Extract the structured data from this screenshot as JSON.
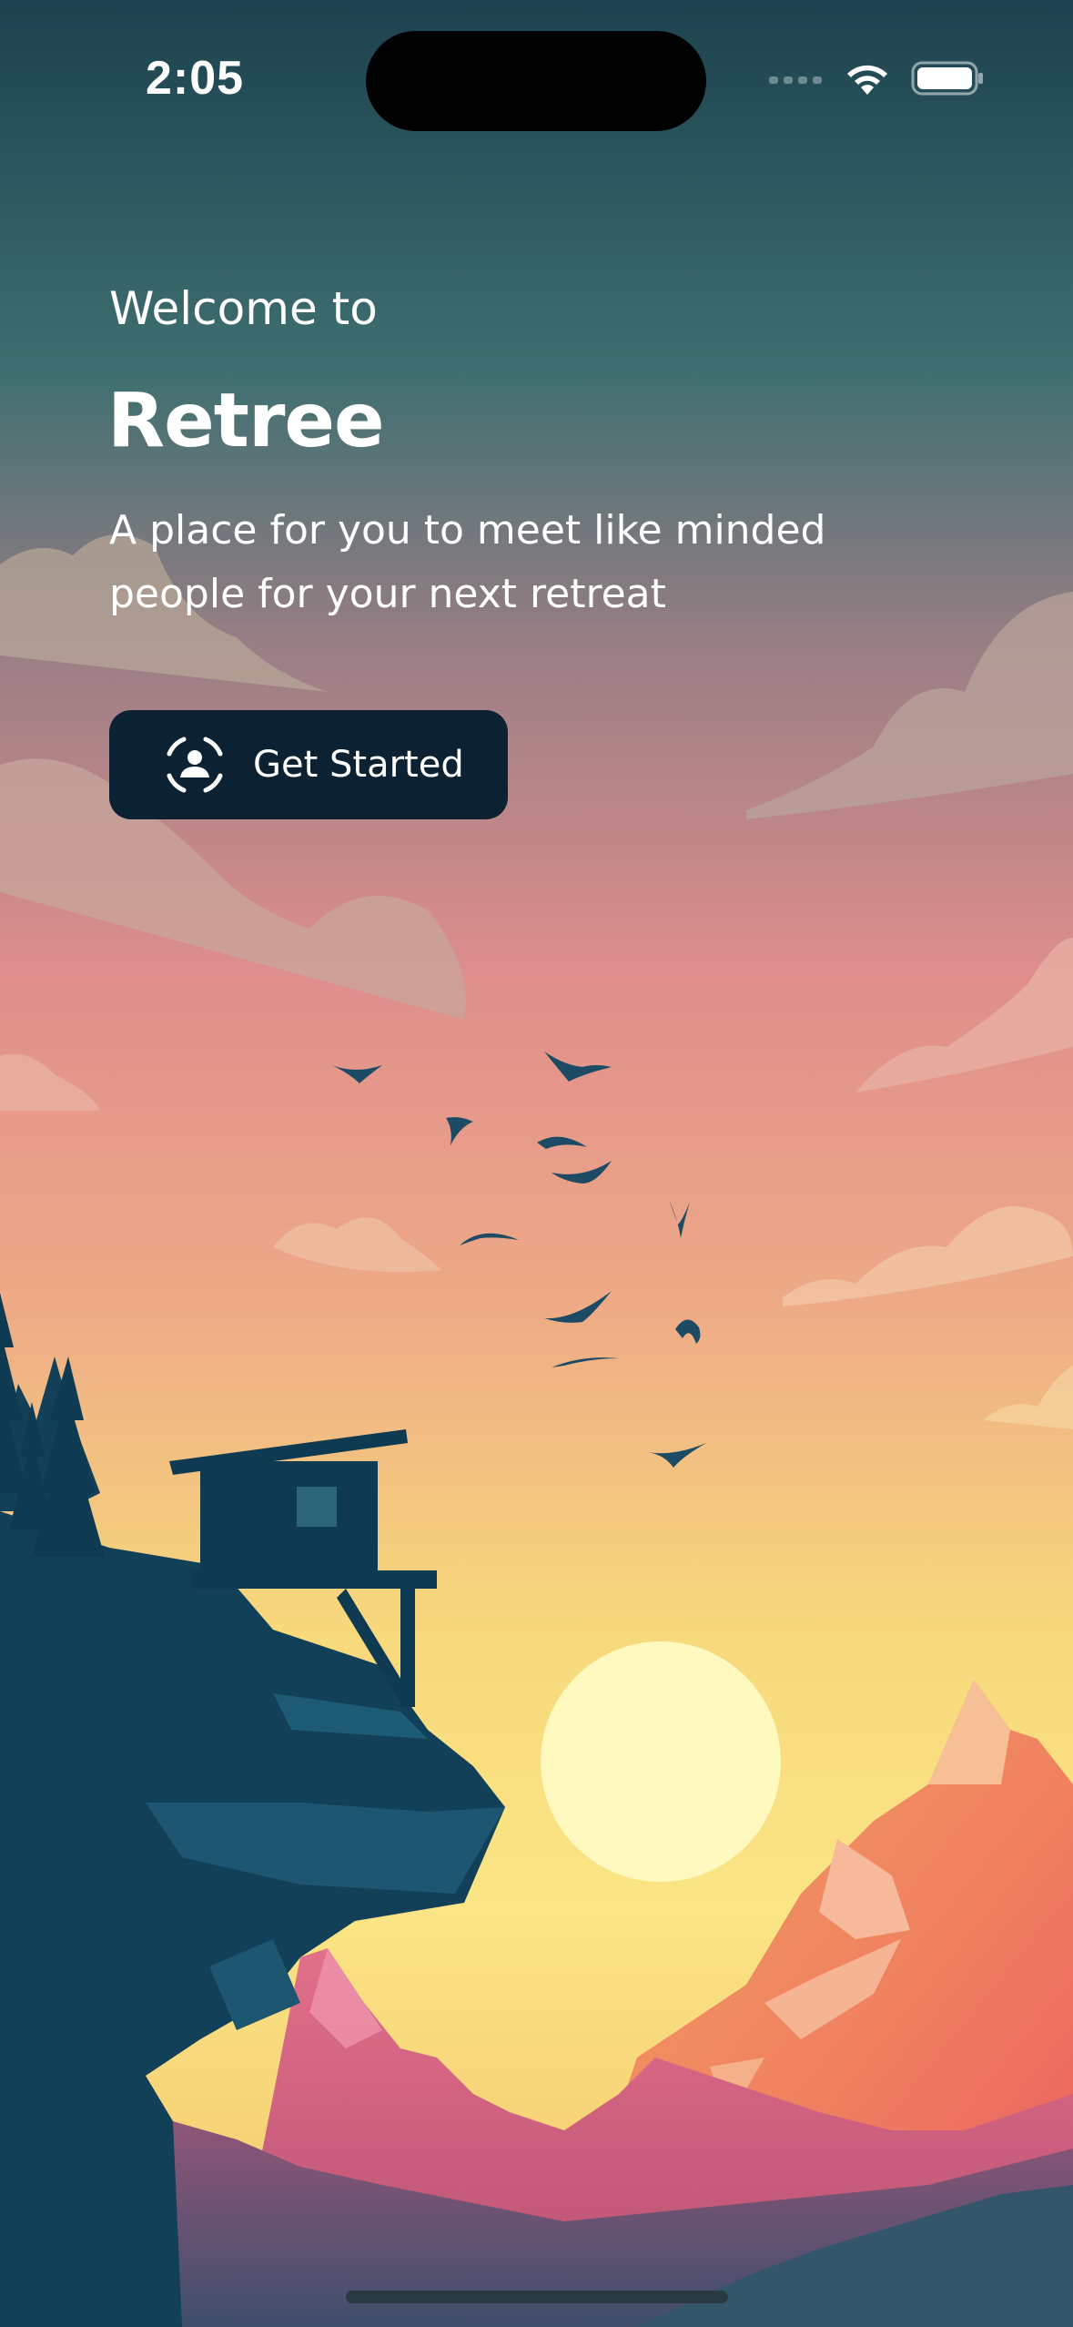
{
  "status_bar": {
    "time": "2:05",
    "icons": [
      "cellular-signal-icon",
      "wifi-icon",
      "battery-icon"
    ]
  },
  "hero": {
    "welcome": "Welcome to",
    "title": "Retree",
    "tagline": "A place for you to meet like minded people for your next retreat"
  },
  "cta": {
    "label": "Get Started",
    "icon": "user-scan-icon"
  },
  "colors": {
    "sky_top": "#1d4650",
    "sky_mid": "#e0908a",
    "sky_bottom": "#f8e27a",
    "button": "#0c2232",
    "silhouette": "#133f57"
  }
}
